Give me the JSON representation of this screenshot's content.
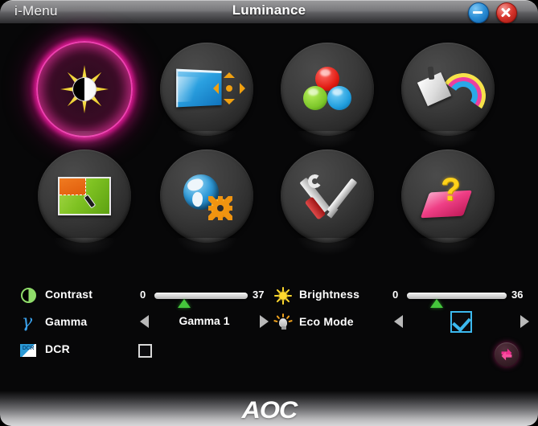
{
  "window": {
    "app_name": "i-Menu",
    "title": "Luminance",
    "minimize_label": "Minimize",
    "close_label": "Close"
  },
  "icon_grid": {
    "items": [
      {
        "id": "luminance",
        "label": "Luminance",
        "icon": "sun-contrast-icon",
        "selected": true
      },
      {
        "id": "image-setup",
        "label": "Image Setup",
        "icon": "monitor-arrows-icon",
        "selected": false
      },
      {
        "id": "color-setup",
        "label": "Color Setup",
        "icon": "rgb-spheres-icon",
        "selected": false
      },
      {
        "id": "picture-boost",
        "label": "Picture Boost",
        "icon": "card-rainbow-icon",
        "selected": false
      },
      {
        "id": "osd-setup",
        "label": "OSD Setup",
        "icon": "green-screen-icon",
        "selected": false
      },
      {
        "id": "language",
        "label": "Language",
        "icon": "globe-gear-icon",
        "selected": false
      },
      {
        "id": "extra",
        "label": "Extra",
        "icon": "wrench-screwdriver-icon",
        "selected": false
      },
      {
        "id": "help",
        "label": "Help",
        "icon": "pink-book-question-icon",
        "selected": false
      }
    ]
  },
  "controls": {
    "contrast": {
      "label": "Contrast",
      "icon": "contrast-half-circle-icon",
      "min": "0",
      "max": "37",
      "value": 37,
      "range_max": 100
    },
    "gamma": {
      "label": "Gamma",
      "icon": "gamma-letter-icon",
      "value": "Gamma 1",
      "prev_label": "Previous",
      "next_label": "Next"
    },
    "dcr": {
      "label": "DCR",
      "icon": "dcr-badge-icon",
      "checked": false
    },
    "brightness": {
      "label": "Brightness",
      "icon": "sun-icon",
      "min": "0",
      "max": "36",
      "value": 36,
      "range_max": 100
    },
    "eco_mode": {
      "label": "Eco Mode",
      "icon": "lightbulb-icon",
      "checked": true,
      "prev_label": "Previous",
      "next_label": "Next"
    }
  },
  "reset": {
    "label": "Reset",
    "icon": "reset-arrows-icon"
  },
  "footer": {
    "brand": "AOC"
  },
  "colors": {
    "accent_pink": "#ff3cb4",
    "slider_thumb_green": "#45c63c",
    "eco_blue": "#3cb9ef",
    "title_bar_grey": "#77777a",
    "background": "#070708"
  }
}
